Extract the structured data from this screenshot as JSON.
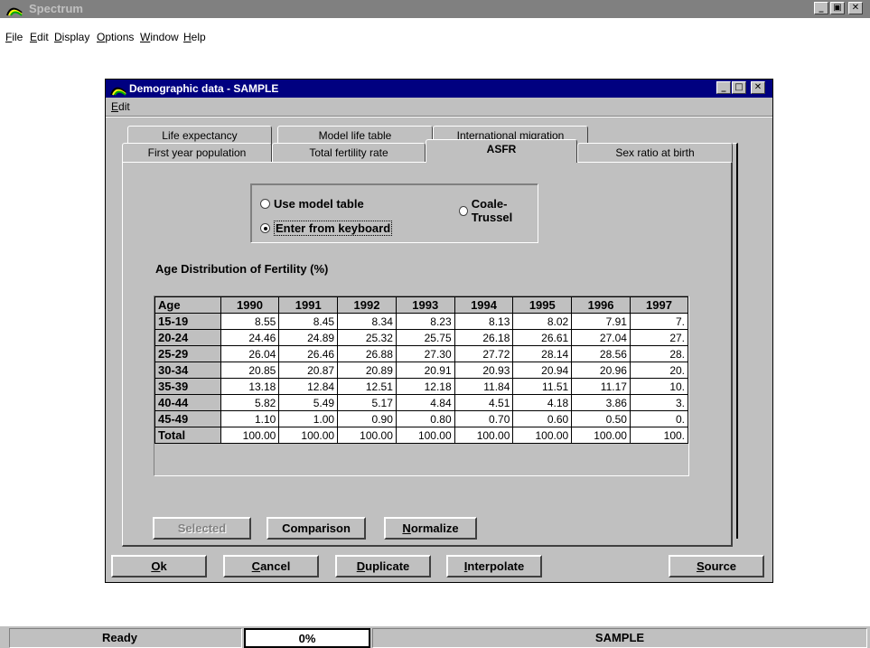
{
  "app": {
    "title": "Spectrum",
    "window_buttons": {
      "minimize": "_",
      "maximize": "▣",
      "close": "✕"
    }
  },
  "menu": [
    "File",
    "Edit",
    "Display",
    "Options",
    "Window",
    "Help"
  ],
  "dialog": {
    "title": "Demographic data - SAMPLE",
    "menu": [
      "Edit"
    ],
    "tabs_back": [
      "Life expectancy",
      "Model life table",
      "International migration"
    ],
    "tabs_front": [
      "First year population",
      "Total fertility rate",
      "ASFR",
      "Sex ratio at birth"
    ],
    "active_tab": "ASFR",
    "radios": [
      {
        "label": "Use model table",
        "checked": false
      },
      {
        "label": "Coale-Trussel",
        "checked": false
      },
      {
        "label": "Enter from keyboard",
        "checked": true
      }
    ],
    "grid_title": "Age Distribution of Fertility (%)",
    "grid": {
      "corner": "Age",
      "columns": [
        "1990",
        "1991",
        "1992",
        "1993",
        "1994",
        "1995",
        "1996",
        "1997"
      ],
      "rows": [
        {
          "label": "15-19",
          "values": [
            "8.55",
            "8.45",
            "8.34",
            "8.23",
            "8.13",
            "8.02",
            "7.91",
            "7."
          ]
        },
        {
          "label": "20-24",
          "values": [
            "24.46",
            "24.89",
            "25.32",
            "25.75",
            "26.18",
            "26.61",
            "27.04",
            "27."
          ]
        },
        {
          "label": "25-29",
          "values": [
            "26.04",
            "26.46",
            "26.88",
            "27.30",
            "27.72",
            "28.14",
            "28.56",
            "28."
          ]
        },
        {
          "label": "30-34",
          "values": [
            "20.85",
            "20.87",
            "20.89",
            "20.91",
            "20.93",
            "20.94",
            "20.96",
            "20."
          ]
        },
        {
          "label": "35-39",
          "values": [
            "13.18",
            "12.84",
            "12.51",
            "12.18",
            "11.84",
            "11.51",
            "11.17",
            "10."
          ]
        },
        {
          "label": "40-44",
          "values": [
            "5.82",
            "5.49",
            "5.17",
            "4.84",
            "4.51",
            "4.18",
            "3.86",
            "3."
          ]
        },
        {
          "label": "45-49",
          "values": [
            "1.10",
            "1.00",
            "0.90",
            "0.80",
            "0.70",
            "0.60",
            "0.50",
            "0."
          ]
        },
        {
          "label": "Total",
          "values": [
            "100.00",
            "100.00",
            "100.00",
            "100.00",
            "100.00",
            "100.00",
            "100.00",
            "100."
          ]
        }
      ]
    },
    "panel_buttons": {
      "selected": "Selected",
      "comparison": "Comparison",
      "normalize": "Normalize"
    },
    "buttons": {
      "ok": "Ok",
      "cancel": "Cancel",
      "duplicate": "Duplicate",
      "interpolate": "Interpolate",
      "source": "Source"
    },
    "title_buttons": {
      "minimize": "_",
      "maximize": "□",
      "close": "✕"
    }
  },
  "status": {
    "left": "Ready",
    "progress": "0%",
    "right": "SAMPLE"
  }
}
